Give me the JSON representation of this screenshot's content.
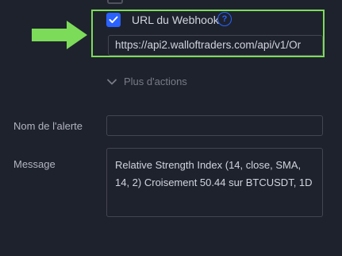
{
  "webhook": {
    "label": "URL du Webhook",
    "checked": true,
    "help_icon": "question-mark-circle-icon",
    "url_value": "https://api2.walloftraders.com/api/v1/Or"
  },
  "more_actions": {
    "label": "Plus d'actions",
    "icon": "chevron-down-icon"
  },
  "alert_name": {
    "label": "Nom de l'alerte",
    "value": ""
  },
  "message": {
    "label": "Message",
    "value": "Relative Strength Index (14, close, SMA, 14, 2) Croisement 50.44 sur BTCUSDT, 1D"
  },
  "colors": {
    "background": "#1e222d",
    "accent_blue": "#2962ff",
    "annotation_green": "#7ddb5a",
    "border": "#434651",
    "muted_text": "#787b86"
  },
  "annotation": {
    "arrow_icon": "green-right-arrow-icon"
  }
}
